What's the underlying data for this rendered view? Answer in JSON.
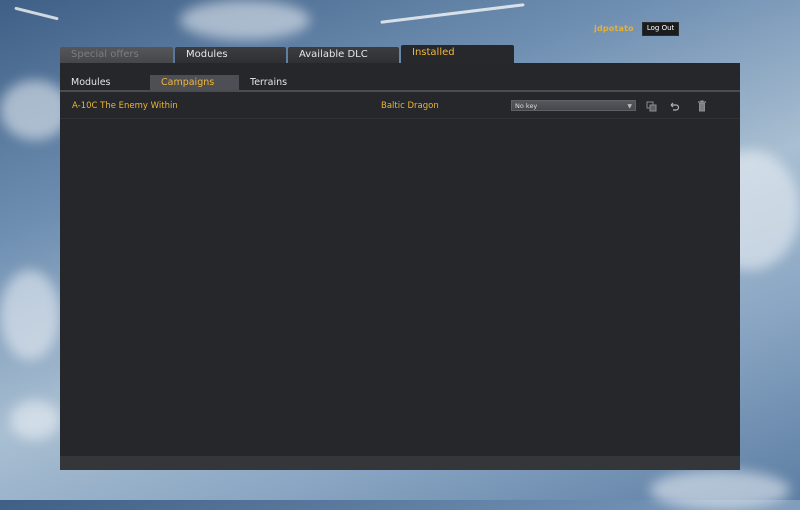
{
  "user": {
    "name": "jdpotato",
    "logout_label": "Log Out"
  },
  "main_tabs": [
    {
      "label": "Special offers",
      "state": "disabled"
    },
    {
      "label": "Modules",
      "state": "normal"
    },
    {
      "label": "Available DLC",
      "state": "normal"
    },
    {
      "label": "Installed",
      "state": "active"
    }
  ],
  "sub_tabs": [
    {
      "label": "Modules",
      "state": "normal"
    },
    {
      "label": "Campaigns",
      "state": "active"
    },
    {
      "label": "Terrains",
      "state": "normal"
    }
  ],
  "campaigns": [
    {
      "name": "A-10C The Enemy Within",
      "campaign": "Baltic Dragon",
      "key": "No key"
    }
  ],
  "colors": {
    "accent": "#f1b73a",
    "panel": "#25272b",
    "tab": "#2e3033"
  },
  "icons": [
    "copy-icon",
    "undo-icon",
    "trash-icon"
  ]
}
